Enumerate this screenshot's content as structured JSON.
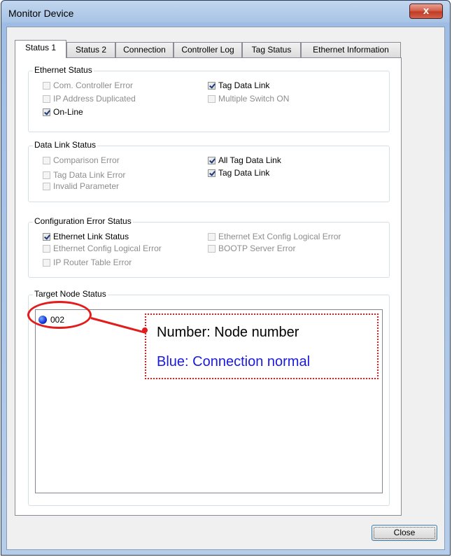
{
  "window": {
    "title": "Monitor Device",
    "close_glyph": "x"
  },
  "tabs": [
    {
      "label": "Status 1",
      "active": true
    },
    {
      "label": "Status 2"
    },
    {
      "label": "Connection"
    },
    {
      "label": "Controller Log"
    },
    {
      "label": "Tag Status"
    },
    {
      "label": "Ethernet Information"
    }
  ],
  "ethernet_status": {
    "title": "Ethernet Status",
    "items": [
      {
        "label": "Com. Controller Error",
        "checked": false,
        "enabled": false
      },
      {
        "label": "IP Address Duplicated",
        "checked": false,
        "enabled": false
      },
      {
        "label": "On-Line",
        "checked": true,
        "enabled": true
      },
      {
        "label": "Tag Data Link",
        "checked": true,
        "enabled": true
      },
      {
        "label": "Multiple Switch ON",
        "checked": false,
        "enabled": false
      }
    ]
  },
  "data_link_status": {
    "title": "Data Link Status",
    "items": [
      {
        "label": "Comparison Error",
        "checked": false,
        "enabled": false
      },
      {
        "label": "Tag Data Link Error",
        "checked": false,
        "enabled": false
      },
      {
        "label": "Invalid Parameter",
        "checked": false,
        "enabled": false
      },
      {
        "label": "All Tag Data Link",
        "checked": true,
        "enabled": true
      },
      {
        "label": "Tag Data Link",
        "checked": true,
        "enabled": true
      }
    ]
  },
  "config_error_status": {
    "title": "Configuration Error Status",
    "items": [
      {
        "label": "Ethernet Link Status",
        "checked": true,
        "enabled": true
      },
      {
        "label": "Ethernet Config Logical Error",
        "checked": false,
        "enabled": false
      },
      {
        "label": "IP Router Table Error",
        "checked": false,
        "enabled": false
      },
      {
        "label": "Ethernet Ext Config Logical Error",
        "checked": false,
        "enabled": false
      },
      {
        "label": "BOOTP Server Error",
        "checked": false,
        "enabled": false
      }
    ]
  },
  "target_node_status": {
    "title": "Target Node Status",
    "nodes": [
      {
        "number": "002",
        "status_color": "#0a34d6"
      }
    ]
  },
  "annotation": {
    "line1": "Number: Node number",
    "line2": "Blue: Connection normal",
    "color": "#e21c1c",
    "line2_color": "#1a1adc"
  },
  "buttons": {
    "close_label": "Close"
  }
}
